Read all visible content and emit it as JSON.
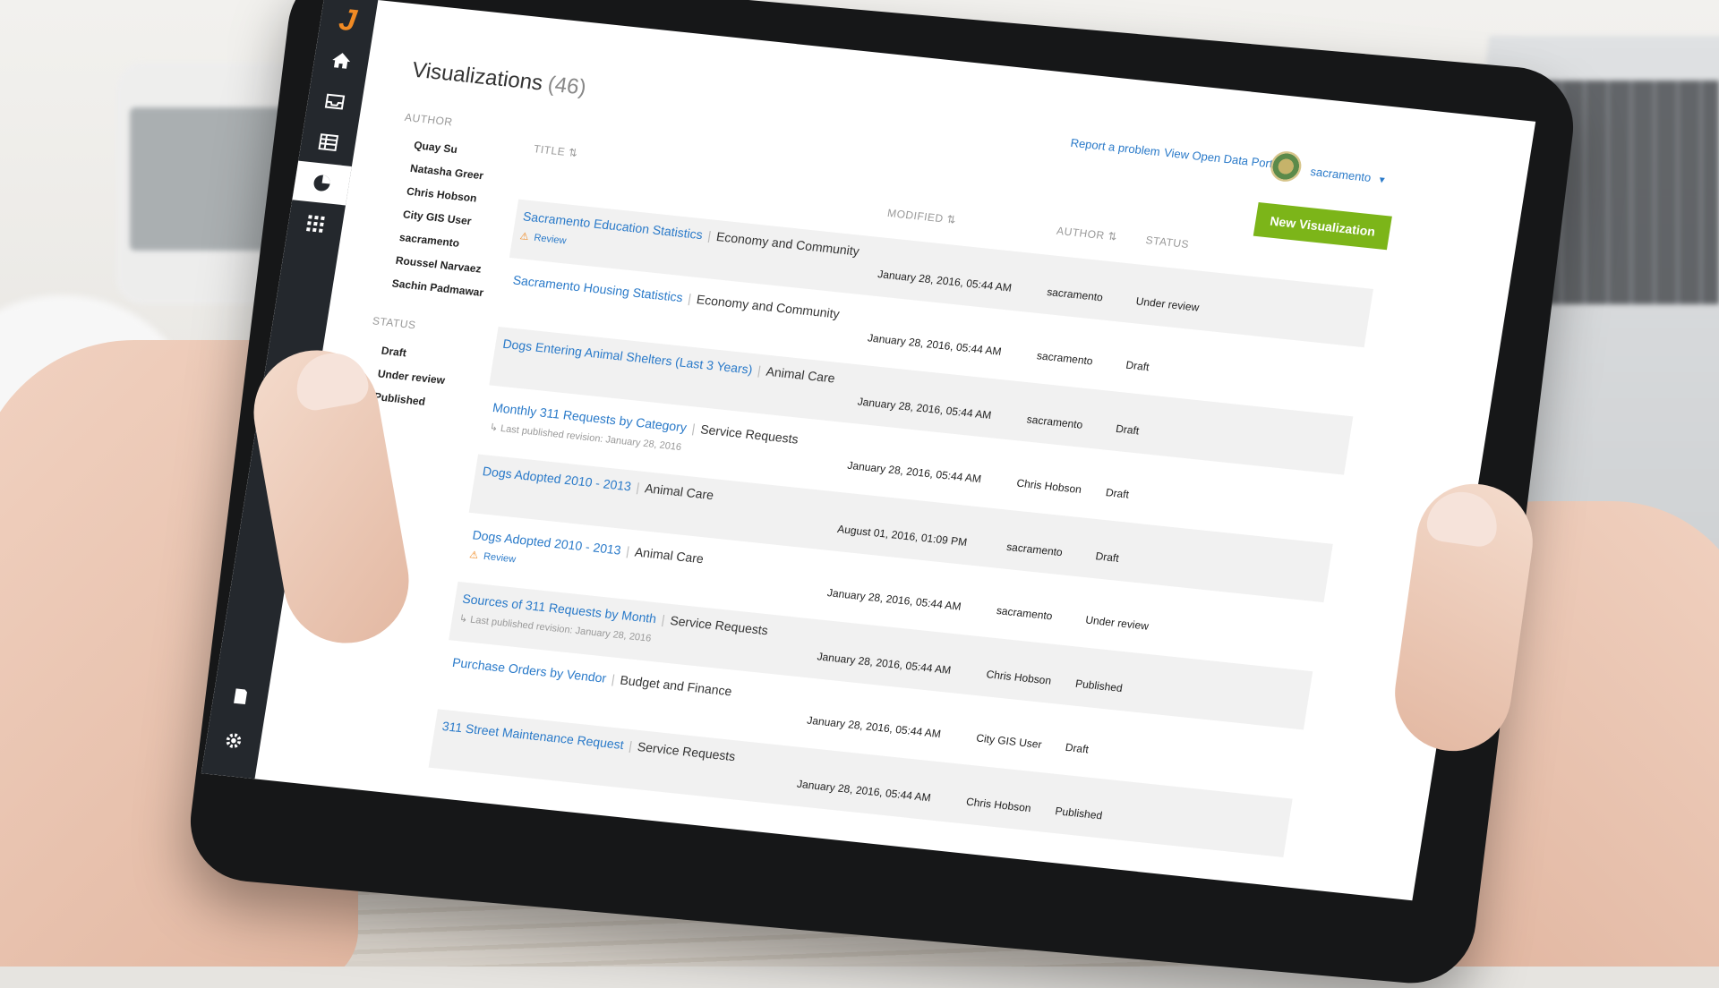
{
  "app": {
    "logo_letter": "J",
    "nav": [
      {
        "icon": "home-icon"
      },
      {
        "icon": "inbox-icon"
      },
      {
        "icon": "table-icon"
      },
      {
        "icon": "pie-chart-icon",
        "active": true
      },
      {
        "icon": "grid-icon"
      }
    ],
    "nav_bottom": [
      {
        "icon": "book-icon"
      },
      {
        "icon": "gear-icon"
      }
    ]
  },
  "header": {
    "title": "Visualizations",
    "count": "(46)",
    "report_link": "Report a problem",
    "portal_link": "View Open Data Portal",
    "user_name": "sacramento",
    "user_caret": "▼",
    "new_button": "New Visualization"
  },
  "filters": {
    "author_heading": "AUTHOR",
    "authors": [
      "Quay Su",
      "Natasha Greer",
      "Chris Hobson",
      "City GIS User",
      "sacramento",
      "Roussel Narvaez",
      "Sachin Padmawar"
    ],
    "status_heading": "STATUS",
    "statuses": [
      "Draft",
      "Under review",
      "Published"
    ]
  },
  "table": {
    "headers": {
      "title": "TITLE",
      "modified": "MODIFIED",
      "author": "AUTHOR",
      "status": "STATUS"
    },
    "rows": [
      {
        "title": "Sacramento Education Statistics",
        "category": "Economy and Community",
        "note": "Review",
        "note_type": "review",
        "modified": "January 28, 2016, 05:44 AM",
        "author": "sacramento",
        "status": "Under review"
      },
      {
        "title": "Sacramento Housing Statistics",
        "category": "Economy and Community",
        "note": "",
        "note_type": "",
        "modified": "January 28, 2016, 05:44 AM",
        "author": "sacramento",
        "status": "Draft"
      },
      {
        "title": "Dogs Entering Animal Shelters (Last 3 Years)",
        "category": "Animal Care",
        "note": "",
        "note_type": "",
        "modified": "January 28, 2016, 05:44 AM",
        "author": "sacramento",
        "status": "Draft"
      },
      {
        "title": "Monthly 311 Requests by Category",
        "category": "Service Requests",
        "note": "Last published revision: January 28, 2016",
        "note_type": "revision",
        "modified": "January 28, 2016, 05:44 AM",
        "author": "Chris Hobson",
        "status": "Draft"
      },
      {
        "title": "Dogs Adopted 2010 - 2013",
        "category": "Animal Care",
        "note": "",
        "note_type": "",
        "modified": "August 01, 2016, 01:09 PM",
        "author": "sacramento",
        "status": "Draft"
      },
      {
        "title": "Dogs Adopted 2010 - 2013",
        "category": "Animal Care",
        "note": "Review",
        "note_type": "review",
        "modified": "January 28, 2016, 05:44 AM",
        "author": "sacramento",
        "status": "Under review"
      },
      {
        "title": "Sources of 311 Requests by Month",
        "category": "Service Requests",
        "note": "Last published revision: January 28, 2016",
        "note_type": "revision",
        "modified": "January 28, 2016, 05:44 AM",
        "author": "Chris Hobson",
        "status": "Published"
      },
      {
        "title": "Purchase Orders by Vendor",
        "category": "Budget and Finance",
        "note": "",
        "note_type": "",
        "modified": "January 28, 2016, 05:44 AM",
        "author": "City GIS User",
        "status": "Draft"
      },
      {
        "title": "311 Street Maintenance Request",
        "category": "Service Requests",
        "note": "",
        "note_type": "",
        "modified": "January 28, 2016, 05:44 AM",
        "author": "Chris Hobson",
        "status": "Published"
      }
    ]
  },
  "colors": {
    "accent_green": "#7cb519",
    "link_blue": "#2a7ac9",
    "sidebar": "#24282d",
    "logo_orange": "#f08a24"
  }
}
